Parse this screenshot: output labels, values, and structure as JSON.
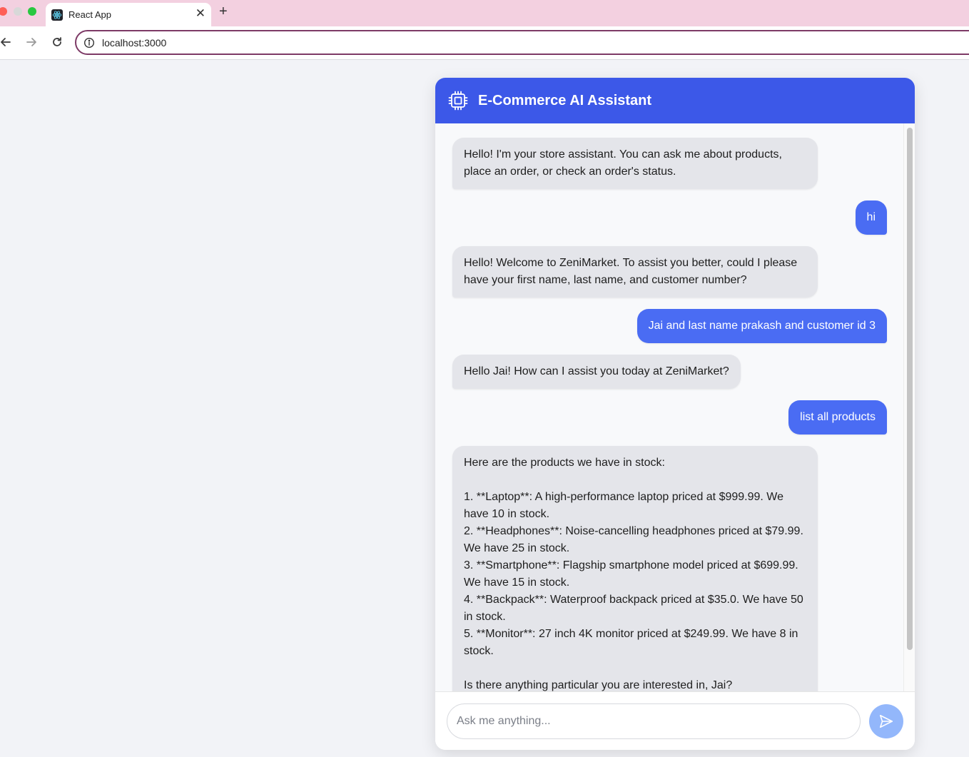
{
  "browser": {
    "tab_title": "React App",
    "url": "localhost:3000"
  },
  "chat": {
    "title": "E-Commerce AI Assistant",
    "input_placeholder": "Ask me anything...",
    "messages": [
      {
        "role": "assistant",
        "text": "Hello! I'm your store assistant. You can ask me about products, place an order, or check an order's status."
      },
      {
        "role": "user",
        "text": "hi"
      },
      {
        "role": "assistant",
        "text": "Hello! Welcome to ZeniMarket. To assist you better, could I please have your first name, last name, and customer number?"
      },
      {
        "role": "user",
        "text": "Jai and last name prakash and customer id 3"
      },
      {
        "role": "assistant",
        "text": "Hello Jai! How can I assist you today at ZeniMarket?"
      },
      {
        "role": "user",
        "text": "list all products"
      },
      {
        "role": "assistant",
        "text": "Here are the products we have in stock:\n\n1. **Laptop**: A high-performance laptop priced at $999.99. We have 10 in stock.\n2. **Headphones**: Noise-cancelling headphones priced at $79.99. We have 25 in stock.\n3. **Smartphone**: Flagship smartphone model priced at $699.99. We have 15 in stock.\n4. **Backpack**: Waterproof backpack priced at $35.0. We have 50 in stock.\n5. **Monitor**: 27 inch 4K monitor priced at $249.99. We have 8 in stock.\n\nIs there anything particular you are interested in, Jai?"
      }
    ]
  },
  "colors": {
    "header": "#3c58e8",
    "user_bubble": "#4a6cf3",
    "bot_bubble": "#e4e5ea",
    "send_button": "#93b7fb"
  },
  "icons": {
    "header": "cpu-chip-icon",
    "send": "send-icon"
  }
}
